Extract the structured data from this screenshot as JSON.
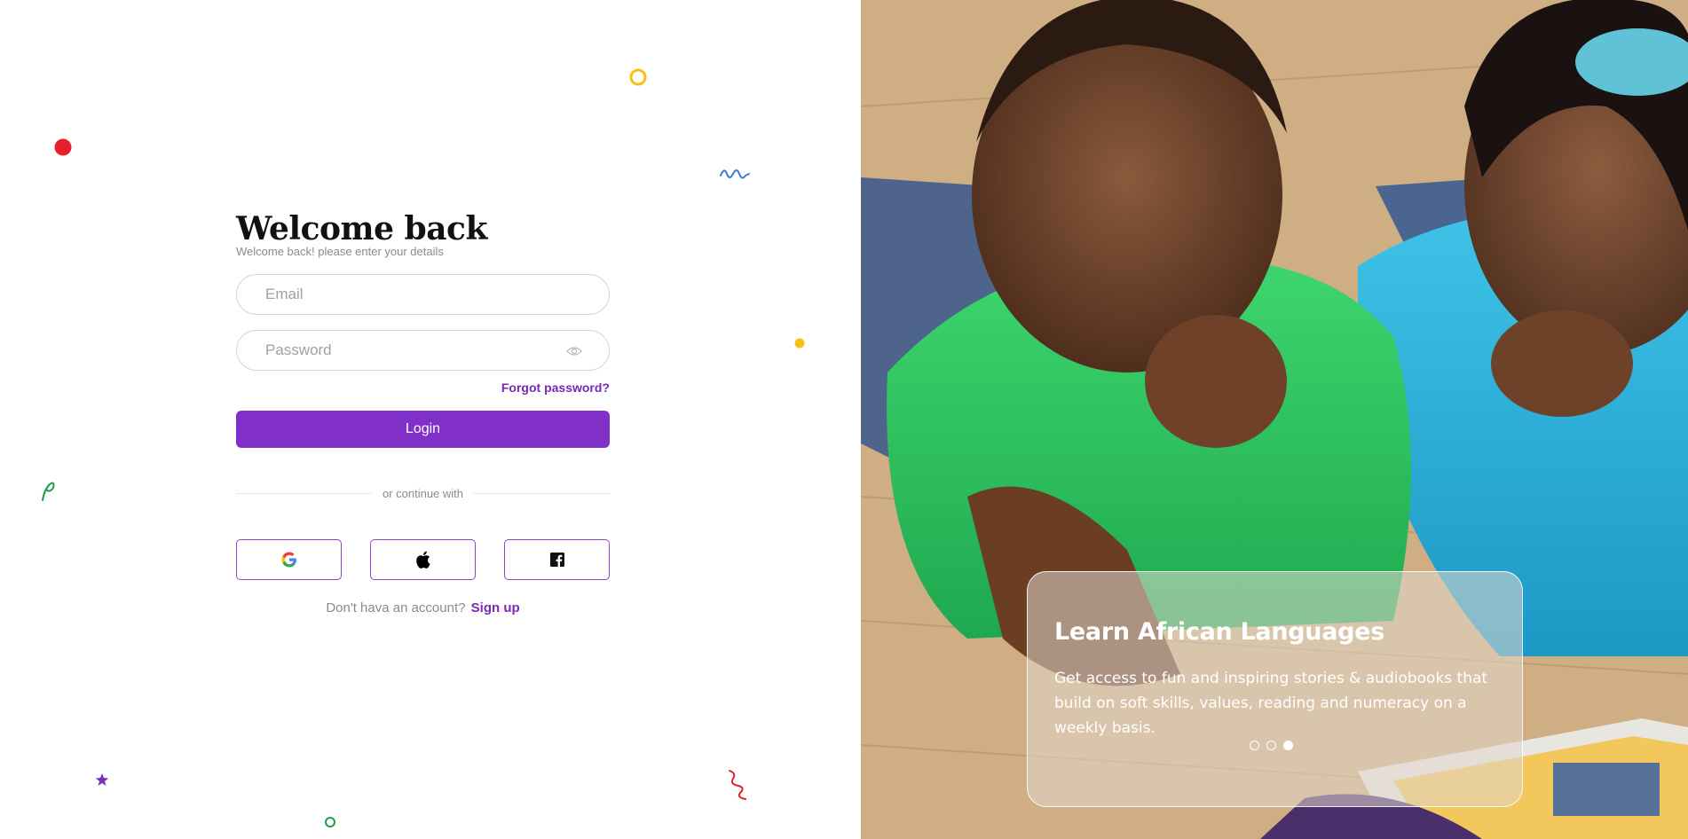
{
  "login": {
    "title": "Welcome back",
    "subtitle": "Welcome back! please enter your details",
    "email_placeholder": "Email",
    "password_placeholder": "Password",
    "forgot_label": "Forgot password?",
    "login_label": "Login",
    "divider_text": "or continue with",
    "social_icons": [
      "google-icon",
      "apple-icon",
      "facebook-icon"
    ],
    "signup_prompt": "Don't hava an account?",
    "signup_label": "Sign up"
  },
  "carousel": {
    "title": "Learn African Languages",
    "description": "Get access to fun and inspiring stories & audiobooks that build on soft skills, values, reading and numeracy on a weekly basis.",
    "total_slides": 3,
    "active_slide": 3
  },
  "colors": {
    "accent": "#8030c8",
    "link": "#7b27b8",
    "field_border": "#e6c9ef"
  }
}
